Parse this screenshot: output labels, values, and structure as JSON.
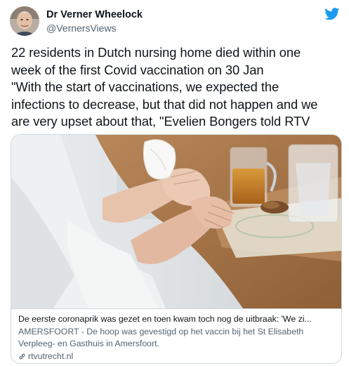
{
  "author": {
    "display_name": "Dr Verner Wheelock",
    "handle": "@VernersViews"
  },
  "tweet": {
    "lines": [
      "22 residents in Dutch nursing home died within one",
      "week of the first Covid vaccination on 30 Jan",
      "\"With the start of vaccinations, we expected the",
      "infections to decrease, but that did not happen and we",
      "are very upset about that, \"Evelien Bongers told RTV"
    ]
  },
  "card": {
    "title": "De eerste coronaprik was gezet en toen kwam toch nog de uitbraak: 'We zi...",
    "description": "AMERSFOORT - De hoop was gevestigd op het vaccin bij het St Elisabeth Verpleeg- en Gasthuis in Amersfoort.",
    "domain": "rtvutrecht.nl"
  },
  "colors": {
    "text_primary": "#0f1419",
    "text_secondary": "#536471",
    "twitter_blue": "#1d9bf0",
    "border": "#cfd9de"
  },
  "icons": [
    "twitter-bird-icon",
    "link-icon"
  ]
}
